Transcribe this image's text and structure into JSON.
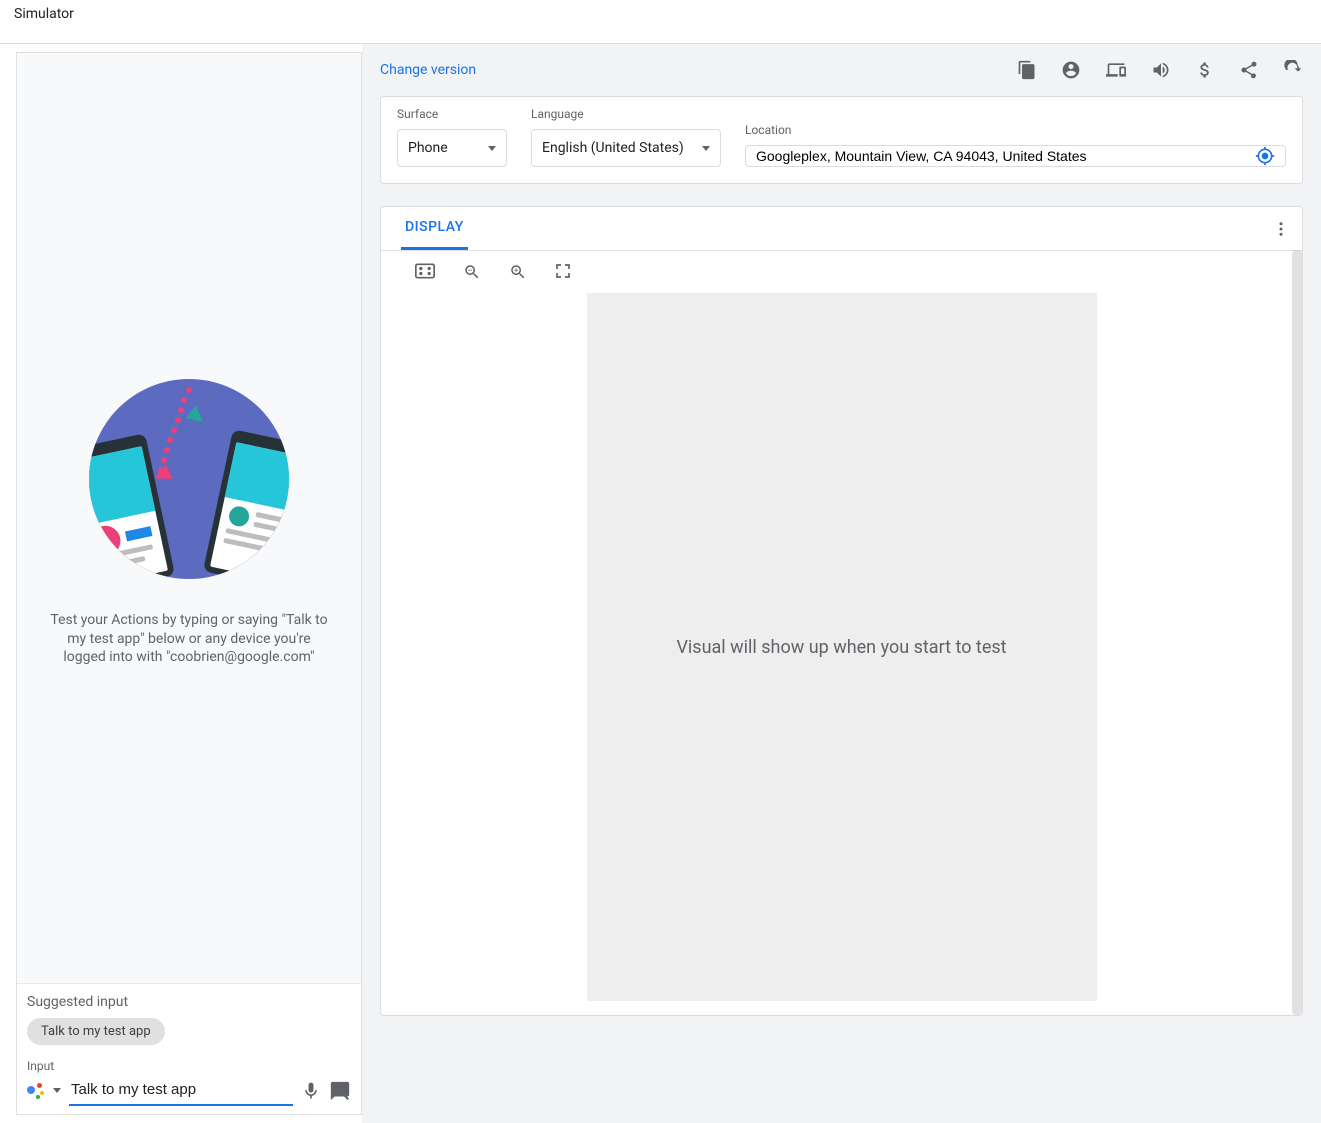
{
  "header": {
    "title": "Simulator"
  },
  "left": {
    "intro": "Test your Actions by typing or saying \"Talk to my test app\" below or any device you're logged into with \"coobrien@google.com\"",
    "suggested_label": "Suggested input",
    "suggestion_chip": "Talk to my test app",
    "input_label": "Input",
    "input_value": "Talk to my test app"
  },
  "right": {
    "change_version": "Change version",
    "settings": {
      "surface_label": "Surface",
      "surface_value": "Phone",
      "language_label": "Language",
      "language_value": "English (United States)",
      "location_label": "Location",
      "location_value": "Googleplex, Mountain View, CA 94043, United States"
    },
    "display": {
      "tab": "DISPLAY",
      "placeholder": "Visual will show up when you start to test"
    }
  }
}
